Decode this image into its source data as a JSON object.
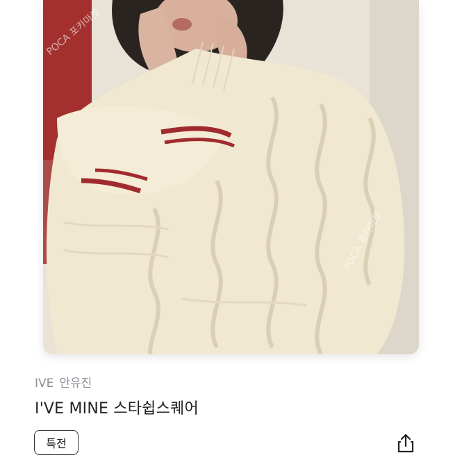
{
  "photo": {
    "description_icon": "photocard-image",
    "watermark_text": "POCA 포카마켓"
  },
  "item": {
    "group": "IVE",
    "member": "안유진",
    "title": "I'VE MINE 스타쉽스퀘어",
    "badge": "특전"
  },
  "actions": {
    "share_icon": "share-icon"
  },
  "colors": {
    "background": "#ffffff",
    "muted_text": "#8b8f96",
    "title_text": "#1f2226",
    "badge_border": "#2b2f35"
  }
}
